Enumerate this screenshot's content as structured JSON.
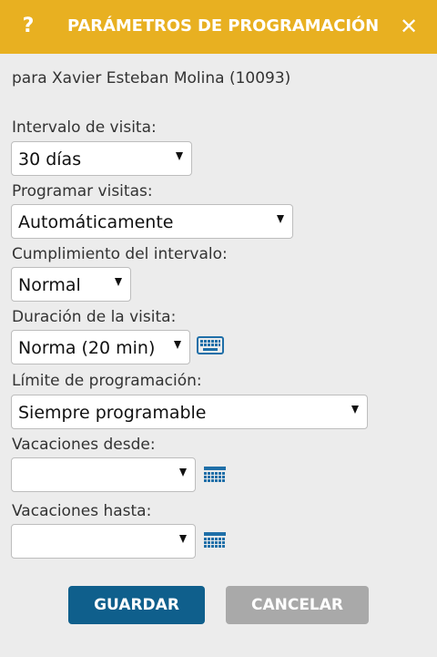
{
  "dialog": {
    "title": "PARÁMETROS DE PROGRAMACIÓN",
    "help_icon_text": "?",
    "close_icon_text": "✕",
    "subtitle": "para Xavier Esteban Molina (10093)"
  },
  "fields": {
    "interval": {
      "label": "Intervalo de visita:",
      "value": "30 días"
    },
    "schedule": {
      "label": "Programar visitas:",
      "value": "Automáticamente"
    },
    "compliance": {
      "label": "Cumplimiento del intervalo:",
      "value": "Normal"
    },
    "duration": {
      "label": "Duración de la visita:",
      "value": "Norma (20 min)"
    },
    "limit": {
      "label": "Límite de programación:",
      "value": "Siempre programable"
    },
    "vacation_from": {
      "label": "Vacaciones desde:",
      "value": ""
    },
    "vacation_to": {
      "label": "Vacaciones hasta:",
      "value": ""
    }
  },
  "icons": {
    "keyboard": "keyboard-icon",
    "calendar": "calendar-icon"
  },
  "buttons": {
    "save": "GUARDAR",
    "cancel": "CANCELAR"
  },
  "colors": {
    "titlebar": "#e8b021",
    "primary_button": "#0f5f8c",
    "secondary_button": "#a9a9a9",
    "icon_blue": "#1f6fa8"
  }
}
